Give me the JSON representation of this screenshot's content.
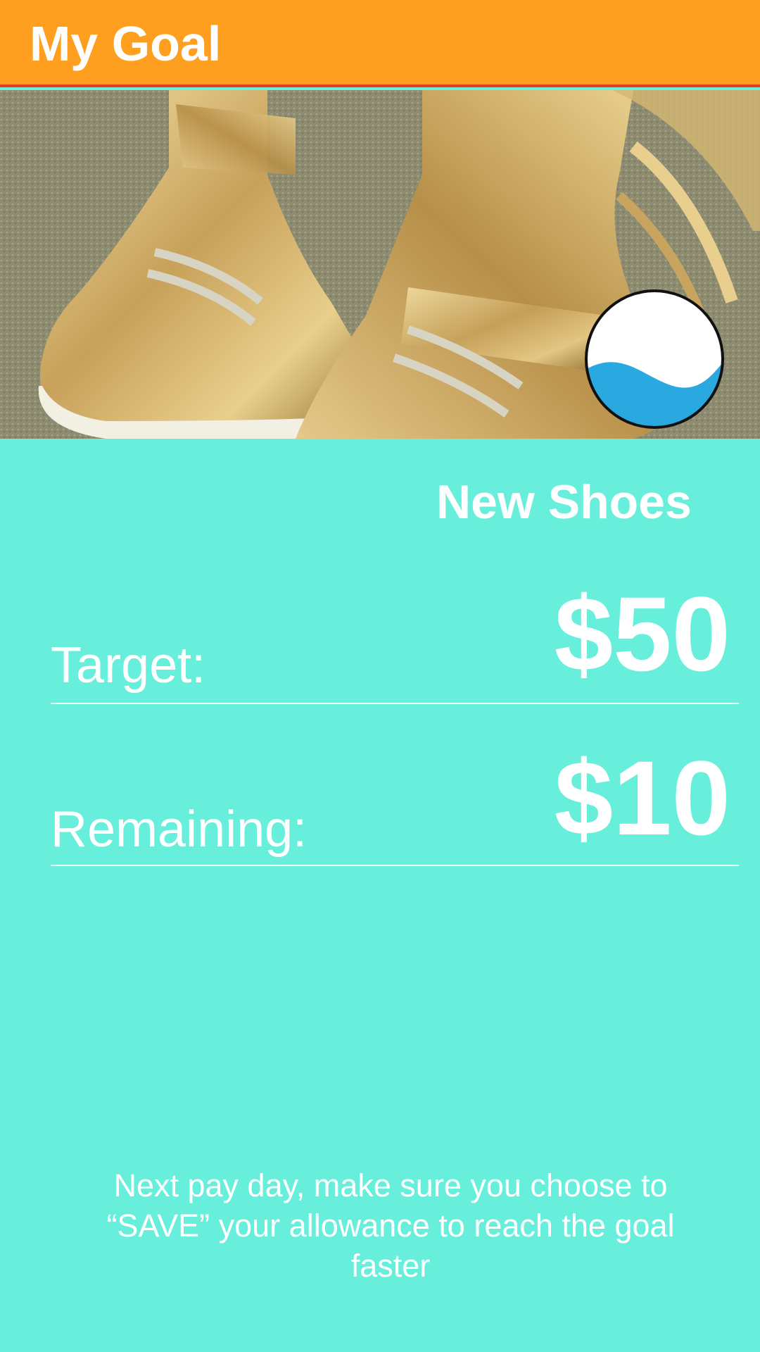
{
  "app_bar": {
    "title": "My Goal",
    "background": "#ff9f1f",
    "accent_line": "#f03a1e"
  },
  "hero": {
    "image_subject": "gold-shoes-photo",
    "progress_indicator": {
      "icon": "wave-progress-icon",
      "fill_fraction": 0.2,
      "fill_color": "#2aa9e0"
    }
  },
  "goal": {
    "name": "New Shoes",
    "target_label": "Target:",
    "target_value": "$50",
    "remaining_label": "Remaining:",
    "remaining_value": "$10"
  },
  "tip": {
    "text": "Next pay day, make sure you choose to “SAVE” your allowance to reach the goal faster"
  },
  "colors": {
    "page_background": "#67efdc",
    "text": "#ffffff"
  }
}
